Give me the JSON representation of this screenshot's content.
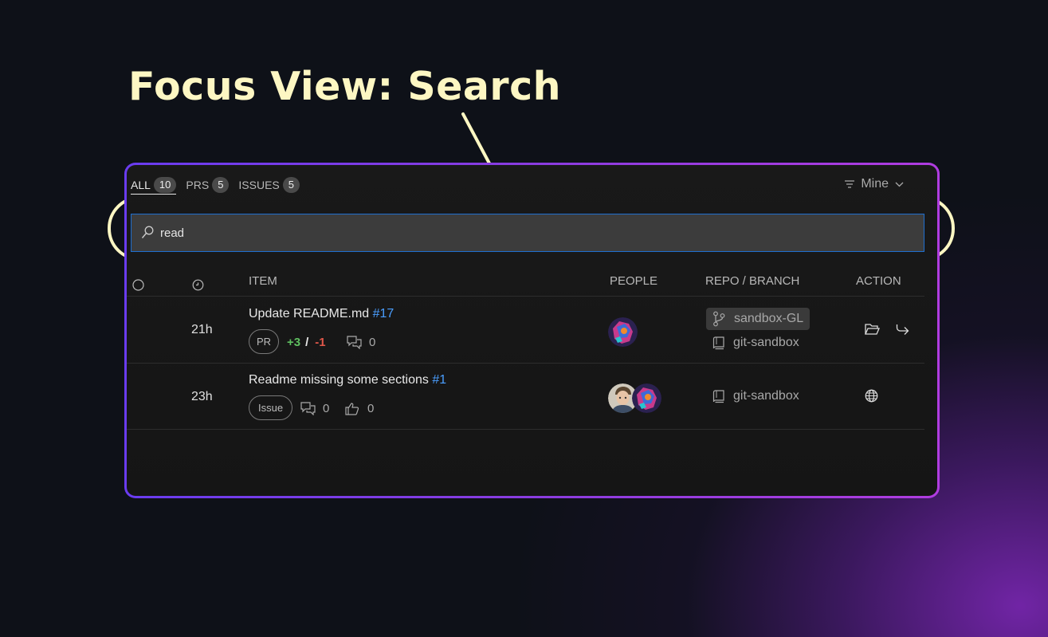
{
  "headline": "Focus View: Search",
  "tabs": [
    {
      "label": "ALL",
      "count": "10"
    },
    {
      "label": "PRS",
      "count": "5"
    },
    {
      "label": "ISSUES",
      "count": "5"
    }
  ],
  "filter": {
    "label": "Mine"
  },
  "search": {
    "value": "read"
  },
  "columns": {
    "item": "ITEM",
    "people": "PEOPLE",
    "repo": "REPO / BRANCH",
    "action": "ACTION"
  },
  "rows": [
    {
      "time": "21h",
      "title": "Update README.md",
      "number": "#17",
      "type": "PR",
      "additions": "+3",
      "slash": "/",
      "deletions": "-1",
      "comments": "0",
      "branch": "sandbox-GL",
      "repo": "git-sandbox",
      "actions": [
        "folder-open-icon",
        "forward-arrow-icon"
      ]
    },
    {
      "time": "23h",
      "title": "Readme missing some sections",
      "number": "#1",
      "type": "Issue",
      "comments": "0",
      "reactions": "0",
      "repo": "git-sandbox",
      "actions": [
        "globe-icon"
      ]
    }
  ],
  "colors": {
    "accent_border": "#8a3ce0",
    "link": "#4a9eff",
    "callout": "#fdf7c3",
    "additions": "#5fbf60",
    "deletions": "#e0574a"
  }
}
